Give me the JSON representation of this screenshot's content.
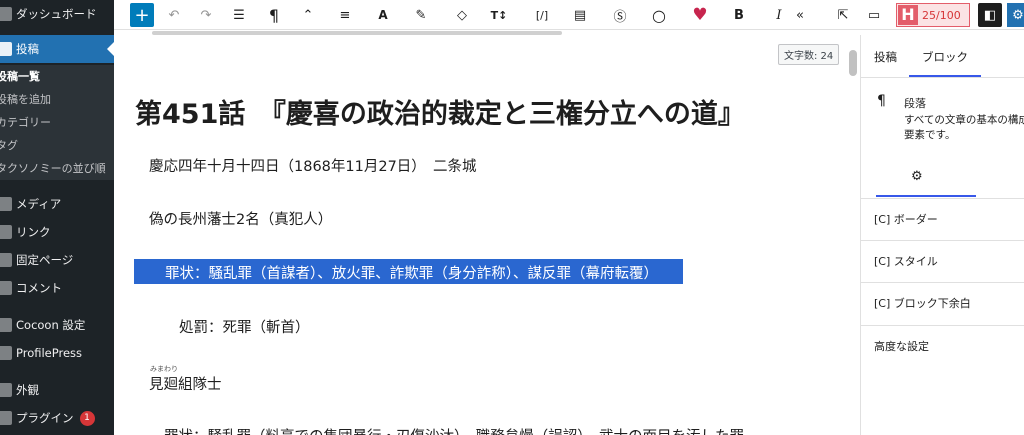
{
  "admin_menu": {
    "dashboard": "ダッシュボード",
    "posts": "投稿",
    "posts_sub": [
      "投稿一覧",
      "投稿を追加",
      "カテゴリー",
      "タグ",
      "タクソノミーの並び順"
    ],
    "media": "メディア",
    "links": "リンク",
    "pages": "固定ページ",
    "comments": "コメント",
    "cocoon": "Cocoon 設定",
    "profilepress": "ProfilePress",
    "appearance": "外観",
    "plugins": "プラグイン",
    "plugins_badge": "1"
  },
  "toolbar": {
    "add": "+",
    "undo": "↶",
    "redo": "↷",
    "list_view": "☰",
    "paragraph": "¶",
    "move": "⌃",
    "align": "≡",
    "text_color": "A",
    "highlight": "✎",
    "tag": "◇",
    "text_size": "T↕",
    "shortcode": "[/]",
    "doc": "▤",
    "dollar": "Ⓢ",
    "circle": "○",
    "heart": "♥",
    "bold": "B",
    "italic": "I",
    "more": "«",
    "external": "⇱",
    "preview": "▭",
    "score_logo": "H",
    "score": "25/100",
    "sidebar_toggle": "◧",
    "settings": "⚙"
  },
  "editor": {
    "char_count": "文字数: 24",
    "title": "第451話　『慶喜の政治的裁定と三権分立への道』",
    "paragraphs": [
      "慶応四年十月十四日（1868年11月27日）　二条城",
      "偽の長州藩士2名（真犯人）",
      "罪状：騒乱罪（首謀者）、放火罪、詐欺罪（身分詐称）、謀反罪（幕府転覆）",
      "処罰：死罪（斬首）",
      "見廻組隊士",
      "罪状：騒乱罪（料亭での集団暴行・刃傷沙汰）、職務怠慢（誤認）、武士の面目を汚した罪"
    ],
    "ruby": "みまわり"
  },
  "panel": {
    "tab_post": "投稿",
    "tab_block": "ブロック",
    "block_icon": "¶",
    "block_name": "段落",
    "block_desc": "すべての文章の基本の構成要素です。",
    "gear": "⚙",
    "sections": [
      "[C] ボーダー",
      "[C] スタイル",
      "[C] ブロック下余白",
      "高度な設定"
    ]
  }
}
